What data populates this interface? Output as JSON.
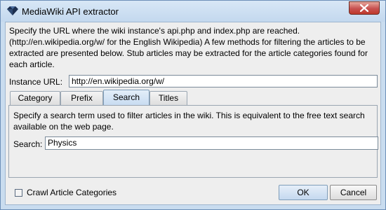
{
  "window": {
    "title": "MediaWiki API extractor",
    "icon": "app-diamond-icon",
    "close_icon": "close-x-icon"
  },
  "description": "Specify the URL where the wiki instance's api.php and index.php are reached. (http://en.wikipedia.org/w/ for the English Wikipedia) A few methods for filtering the articles to be extracted are presented below. Stub articles may be extracted for the article categories found for each article.",
  "instance_url": {
    "label": "Instance URL:",
    "value": "http://en.wikipedia.org/w/"
  },
  "tabs": [
    {
      "label": "Category",
      "active": false
    },
    {
      "label": "Prefix",
      "active": false
    },
    {
      "label": "Search",
      "active": true
    },
    {
      "label": "Titles",
      "active": false
    }
  ],
  "search_panel": {
    "description": "Specify a search term used to filter articles in the wiki. This is equivalent to the free text search available on the web page.",
    "label": "Search:",
    "value": "Physics"
  },
  "crawl_categories": {
    "label": "Crawl Article Categories",
    "checked": false
  },
  "buttons": {
    "ok": "OK",
    "cancel": "Cancel"
  },
  "colors": {
    "frame": "#c9dcef",
    "client": "#eeeeee",
    "active_tab": "#c7dbf1",
    "close_button": "#c75050"
  }
}
